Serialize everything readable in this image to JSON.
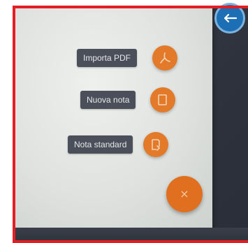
{
  "menu": {
    "items": [
      {
        "label": "Importa PDF",
        "icon": "pdf-icon"
      },
      {
        "label": "Nuova nota",
        "icon": "note-icon"
      },
      {
        "label": "Nota standard",
        "icon": "template-note-icon"
      }
    ],
    "close_symbol": "×"
  },
  "colors": {
    "accent": "#e0701f",
    "chip_bg": "#4a4f5a",
    "chip_text": "#e6e7ea",
    "corner_button": "#1d6fb5",
    "frame_border": "#e31e24"
  }
}
